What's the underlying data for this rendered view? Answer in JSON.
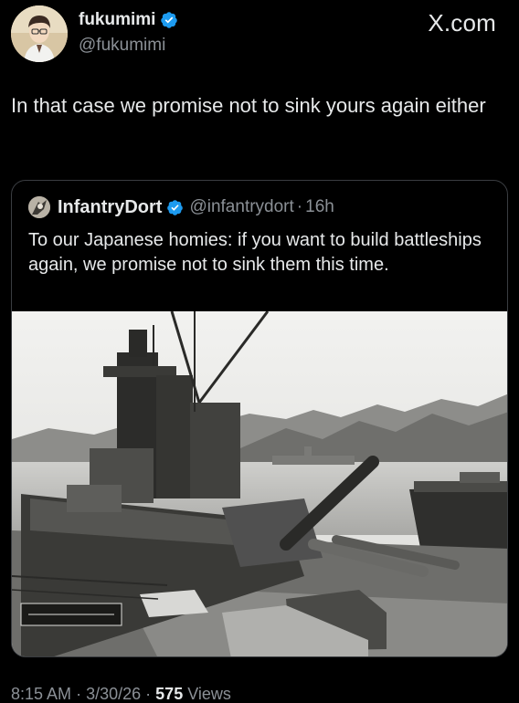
{
  "author": {
    "display_name": "fukumimi",
    "handle": "@fukumimi",
    "verified": true
  },
  "brand": "X.com",
  "tweet_text": "In that case we promise not to sink yours again either",
  "quoted": {
    "display_name": "InfantryDort",
    "handle": "@infantrydort",
    "separator": "·",
    "age": "16h",
    "verified": true,
    "text": "To our Japanese homies: if you want to build battleships again, we promise not to sink them this time."
  },
  "photo_caption_stamp": "",
  "meta": {
    "time": "8:15 AM",
    "separator": "·",
    "date": "3/30/26",
    "views_count": "575",
    "views_label": "Views"
  },
  "colors": {
    "background": "#000000",
    "text": "#e7e9ea",
    "muted": "#8b9096",
    "verified_blue": "#1d9bf0",
    "border": "#3a3d41"
  },
  "icons": [
    "verified-badge-icon"
  ]
}
